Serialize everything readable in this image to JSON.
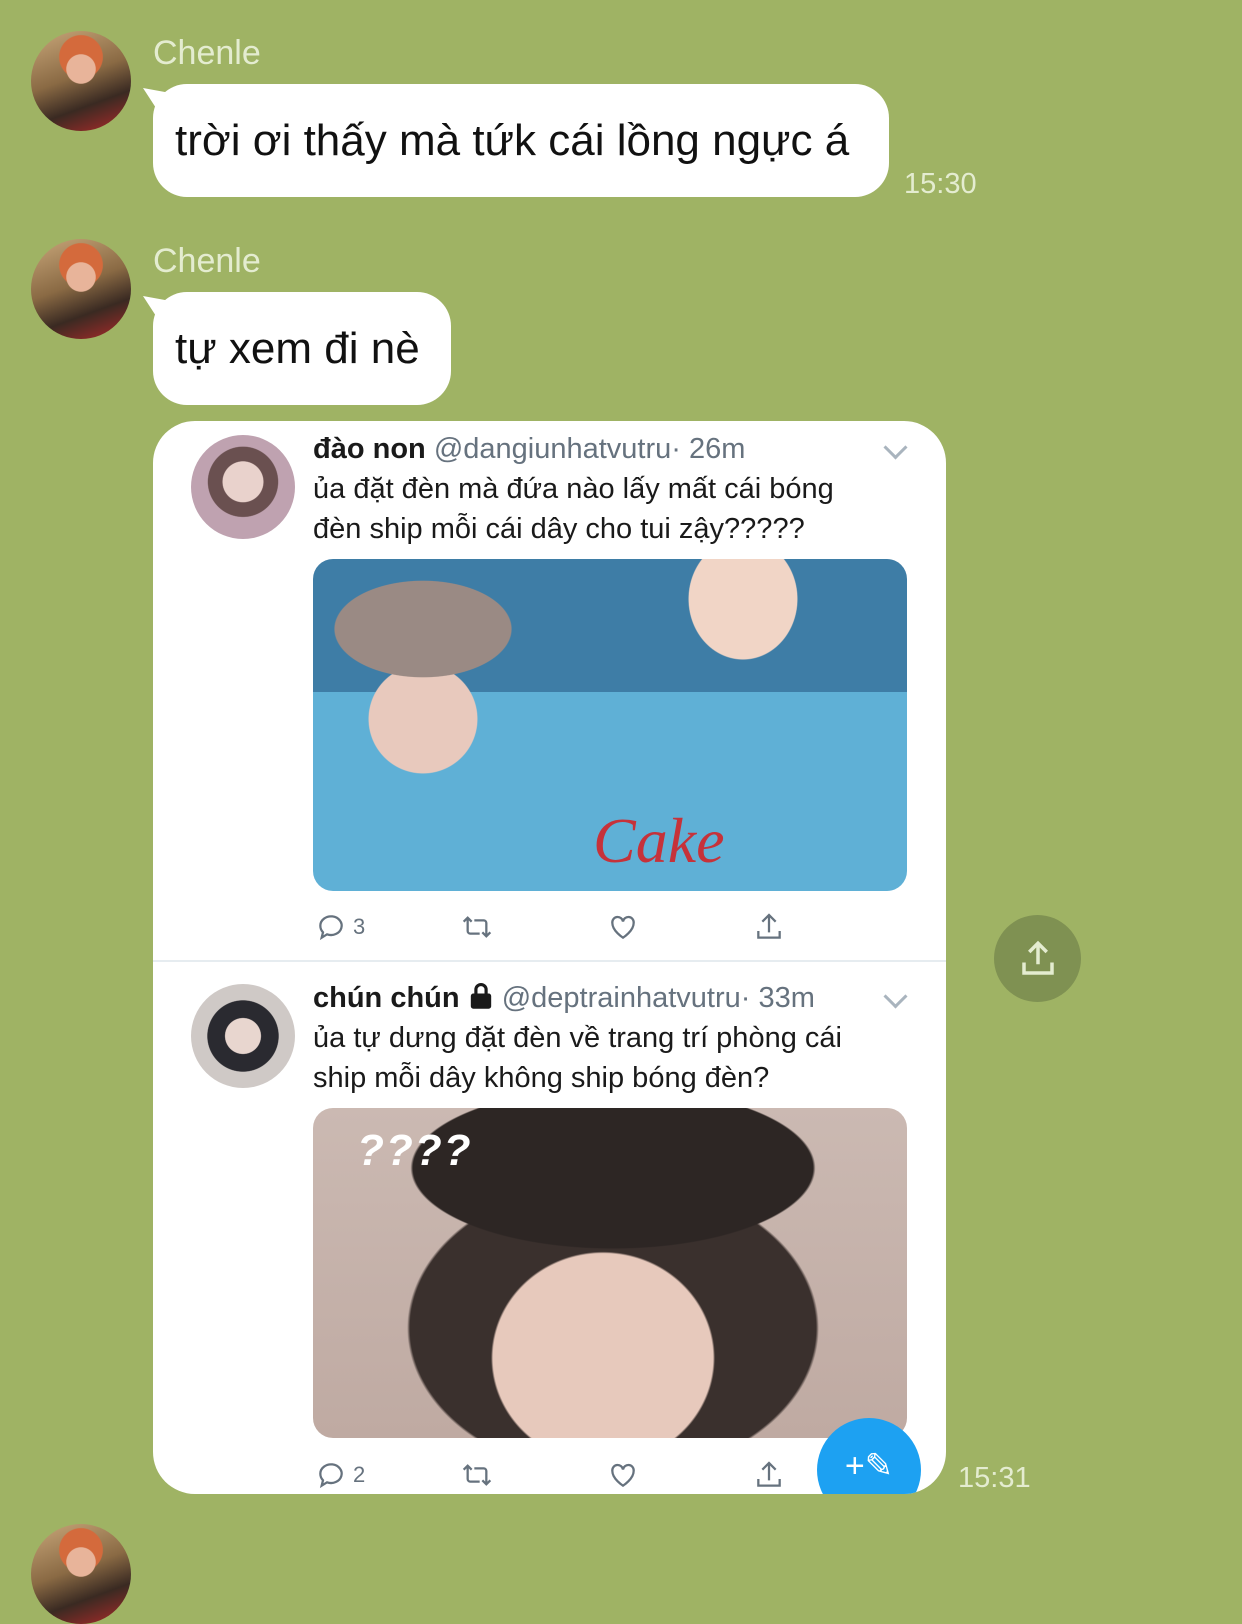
{
  "messages": [
    {
      "sender": "Chenle",
      "text": "trời ơi thấy mà tứk cái lồng ngực á",
      "time": "15:30"
    },
    {
      "sender": "Chenle",
      "text": "tự xem đi nè"
    }
  ],
  "shared_image": {
    "time": "15:31",
    "tweets": [
      {
        "name": "đào non",
        "handle": "@dangiunhatvutru",
        "age": "· 26m",
        "text": "ủa đặt đèn mà đứa nào lấy mất cái bóng đèn ship mỗi cái dây cho tui zậy?????",
        "media_text": "Cake",
        "reply_count": "3"
      },
      {
        "name": "chún chún",
        "handle": "@deptrainhatvutru",
        "age": "· 33m",
        "text": "ủa tự dưng đặt đèn về trang trí phòng cái ship mỗi dây không ship bóng đèn?",
        "media_text": "????",
        "reply_count": "2"
      }
    ]
  },
  "icons": {
    "reply": "reply-icon",
    "retweet": "retweet-icon",
    "like": "heart-icon",
    "share": "share-icon",
    "lock": "lock-icon",
    "compose": "compose-tweet-icon",
    "caret": "chevron-down-icon"
  },
  "colors": {
    "chat_background": "#9fb364",
    "bubble": "#ffffff",
    "twitter_blue": "#1da1f2"
  }
}
